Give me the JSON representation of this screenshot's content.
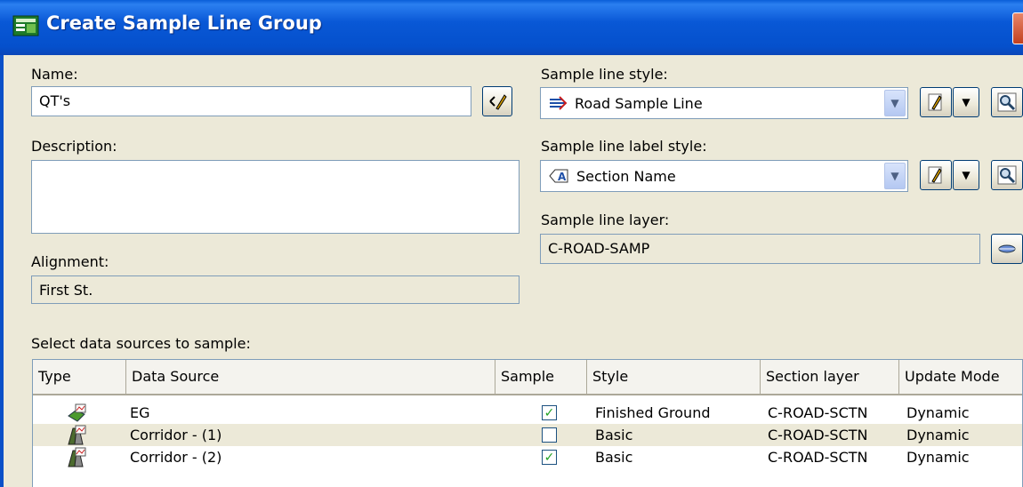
{
  "window": {
    "title": "Create Sample Line Group"
  },
  "name": {
    "label": "Name:",
    "value": "QT's"
  },
  "description": {
    "label": "Description:",
    "value": ""
  },
  "alignment": {
    "label": "Alignment:",
    "value": "First St."
  },
  "sample_line_style": {
    "label": "Sample line style:",
    "value": "Road Sample Line"
  },
  "sample_line_label_style": {
    "label": "Sample line label style:",
    "value": "Section Name"
  },
  "sample_line_layer": {
    "label": "Sample line layer:",
    "value": "C-ROAD-SAMP"
  },
  "data_sources": {
    "label": "Select data sources to sample:",
    "columns": [
      "Type",
      "Data Source",
      "Sample",
      "Style",
      "Section layer",
      "Update Mode"
    ],
    "rows": [
      {
        "icon": "surface-icon",
        "source": "EG",
        "sample": true,
        "style": "Finished Ground",
        "section_layer": "C-ROAD-SCTN",
        "update_mode": "Dynamic"
      },
      {
        "icon": "corridor-icon",
        "source": "Corridor - (1)",
        "sample": false,
        "style": "Basic",
        "section_layer": "C-ROAD-SCTN",
        "update_mode": "Dynamic"
      },
      {
        "icon": "corridor-icon",
        "source": "Corridor - (2)",
        "sample": true,
        "style": "Basic",
        "section_layer": "C-ROAD-SCTN",
        "update_mode": "Dynamic"
      }
    ]
  }
}
